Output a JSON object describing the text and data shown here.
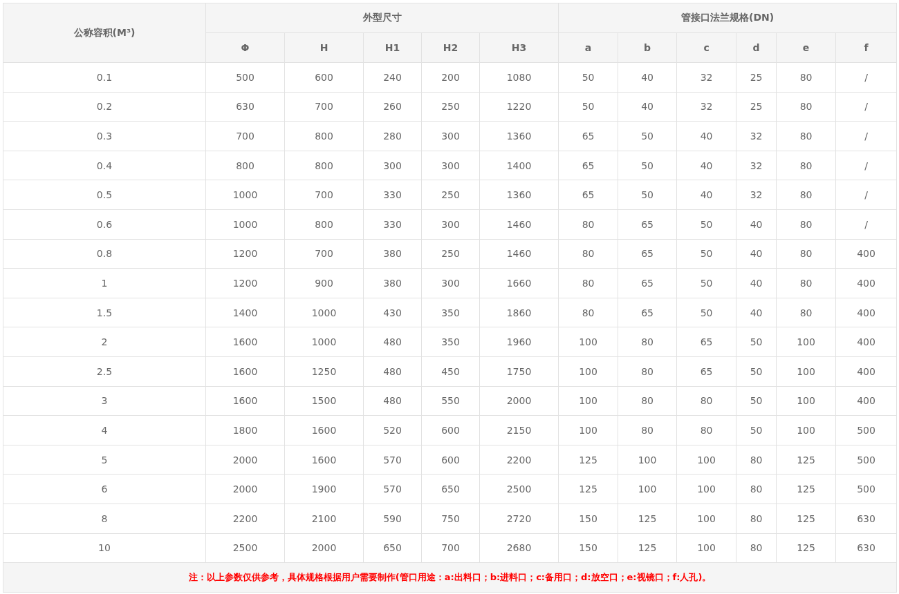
{
  "table": {
    "corner_header": "公称容积(M³)",
    "groups": [
      {
        "label": "外型尺寸",
        "columns": [
          "Φ",
          "H",
          "H1",
          "H2",
          "H3"
        ]
      },
      {
        "label": "管接口法兰规格(DN)",
        "columns": [
          "a",
          "b",
          "c",
          "d",
          "e",
          "f"
        ]
      }
    ],
    "rows": [
      [
        "0.1",
        "500",
        "600",
        "240",
        "200",
        "1080",
        "50",
        "40",
        "32",
        "25",
        "80",
        "/"
      ],
      [
        "0.2",
        "630",
        "700",
        "260",
        "250",
        "1220",
        "50",
        "40",
        "32",
        "25",
        "80",
        "/"
      ],
      [
        "0.3",
        "700",
        "800",
        "280",
        "300",
        "1360",
        "65",
        "50",
        "40",
        "32",
        "80",
        "/"
      ],
      [
        "0.4",
        "800",
        "800",
        "300",
        "300",
        "1400",
        "65",
        "50",
        "40",
        "32",
        "80",
        "/"
      ],
      [
        "0.5",
        "1000",
        "700",
        "330",
        "250",
        "1360",
        "65",
        "50",
        "40",
        "32",
        "80",
        "/"
      ],
      [
        "0.6",
        "1000",
        "800",
        "330",
        "300",
        "1460",
        "80",
        "65",
        "50",
        "40",
        "80",
        "/"
      ],
      [
        "0.8",
        "1200",
        "700",
        "380",
        "250",
        "1460",
        "80",
        "65",
        "50",
        "40",
        "80",
        "400"
      ],
      [
        "1",
        "1200",
        "900",
        "380",
        "300",
        "1660",
        "80",
        "65",
        "50",
        "40",
        "80",
        "400"
      ],
      [
        "1.5",
        "1400",
        "1000",
        "430",
        "350",
        "1860",
        "80",
        "65",
        "50",
        "40",
        "80",
        "400"
      ],
      [
        "2",
        "1600",
        "1000",
        "480",
        "350",
        "1960",
        "100",
        "80",
        "65",
        "50",
        "100",
        "400"
      ],
      [
        "2.5",
        "1600",
        "1250",
        "480",
        "450",
        "1750",
        "100",
        "80",
        "65",
        "50",
        "100",
        "400"
      ],
      [
        "3",
        "1600",
        "1500",
        "480",
        "550",
        "2000",
        "100",
        "80",
        "80",
        "50",
        "100",
        "400"
      ],
      [
        "4",
        "1800",
        "1600",
        "520",
        "600",
        "2150",
        "100",
        "80",
        "80",
        "50",
        "100",
        "500"
      ],
      [
        "5",
        "2000",
        "1600",
        "570",
        "600",
        "2200",
        "125",
        "100",
        "100",
        "80",
        "125",
        "500"
      ],
      [
        "6",
        "2000",
        "1900",
        "570",
        "650",
        "2500",
        "125",
        "100",
        "100",
        "80",
        "125",
        "500"
      ],
      [
        "8",
        "2200",
        "2100",
        "590",
        "750",
        "2720",
        "150",
        "125",
        "100",
        "80",
        "125",
        "630"
      ],
      [
        "10",
        "2500",
        "2000",
        "650",
        "700",
        "2680",
        "150",
        "125",
        "100",
        "80",
        "125",
        "630"
      ]
    ],
    "note": "注：以上参数仅供参考，具体规格根据用户需要制作(管口用途：a:出料口；b:进料口；c:备用口；d:放空口；e:视镜口；f:人孔)。"
  }
}
